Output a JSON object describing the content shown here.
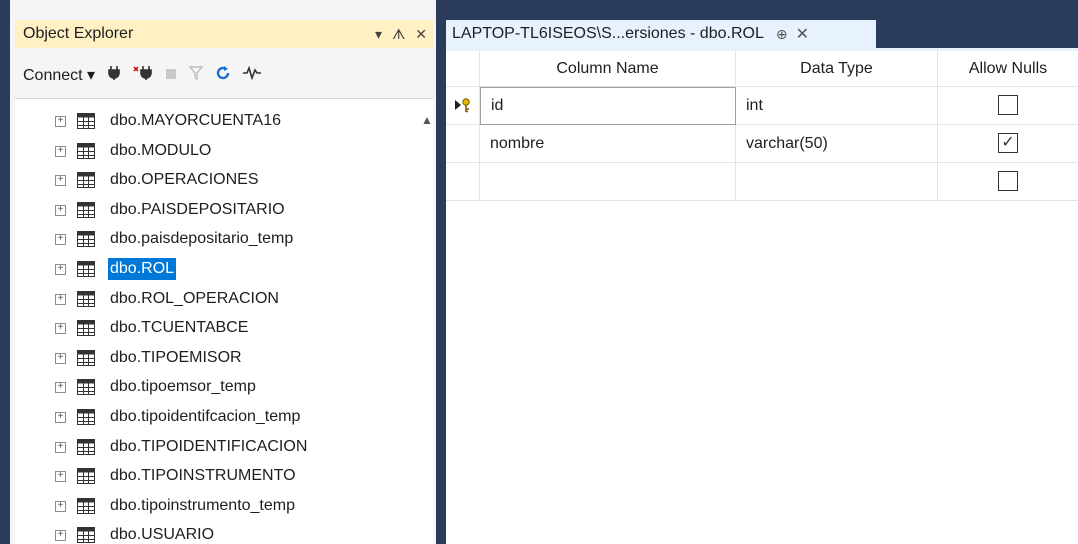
{
  "object_explorer": {
    "title": "Object Explorer",
    "title_controls": {
      "dropdown": "▾",
      "pin": "ᗑ",
      "close": "✕"
    },
    "toolbar": {
      "connect_label": "Connect ▾",
      "icons": [
        "connect-icon",
        "disconnect-icon",
        "stop-icon",
        "filter-icon",
        "refresh-icon",
        "activity-monitor-icon"
      ]
    },
    "tree_items": [
      {
        "label": "dbo.MAYORCUENTA16",
        "selected": false
      },
      {
        "label": "dbo.MODULO",
        "selected": false
      },
      {
        "label": "dbo.OPERACIONES",
        "selected": false
      },
      {
        "label": "dbo.PAISDEPOSITARIO",
        "selected": false
      },
      {
        "label": "dbo.paisdepositario_temp",
        "selected": false
      },
      {
        "label": "dbo.ROL",
        "selected": true
      },
      {
        "label": "dbo.ROL_OPERACION",
        "selected": false
      },
      {
        "label": "dbo.TCUENTABCE",
        "selected": false
      },
      {
        "label": "dbo.TIPOEMISOR",
        "selected": false
      },
      {
        "label": "dbo.tipoemsor_temp",
        "selected": false
      },
      {
        "label": "dbo.tipoidentifcacion_temp",
        "selected": false
      },
      {
        "label": "dbo.TIPOIDENTIFICACION",
        "selected": false
      },
      {
        "label": "dbo.TIPOINSTRUMENTO",
        "selected": false
      },
      {
        "label": "dbo.tipoinstrumento_temp",
        "selected": false
      },
      {
        "label": "dbo.USUARIO",
        "selected": false
      }
    ]
  },
  "document_tab": {
    "label": "LAPTOP-TL6ISEOS\\S...ersiones - dbo.ROL",
    "pin": "⊕",
    "close": "✕"
  },
  "designer": {
    "headers": {
      "column_name": "Column Name",
      "data_type": "Data Type",
      "allow_nulls": "Allow Nulls"
    },
    "rows": [
      {
        "column_name": "id",
        "data_type": "int",
        "allow_nulls": false,
        "primary_key": true
      },
      {
        "column_name": "nombre",
        "data_type": "varchar(50)",
        "allow_nulls": true,
        "primary_key": false
      },
      {
        "column_name": "",
        "data_type": "",
        "allow_nulls": false,
        "primary_key": false
      }
    ]
  },
  "colors": {
    "frame": "#2b3b5c",
    "active_title": "#fff1c4",
    "tab": "#e8f2ff",
    "selection": "#0078d7"
  }
}
